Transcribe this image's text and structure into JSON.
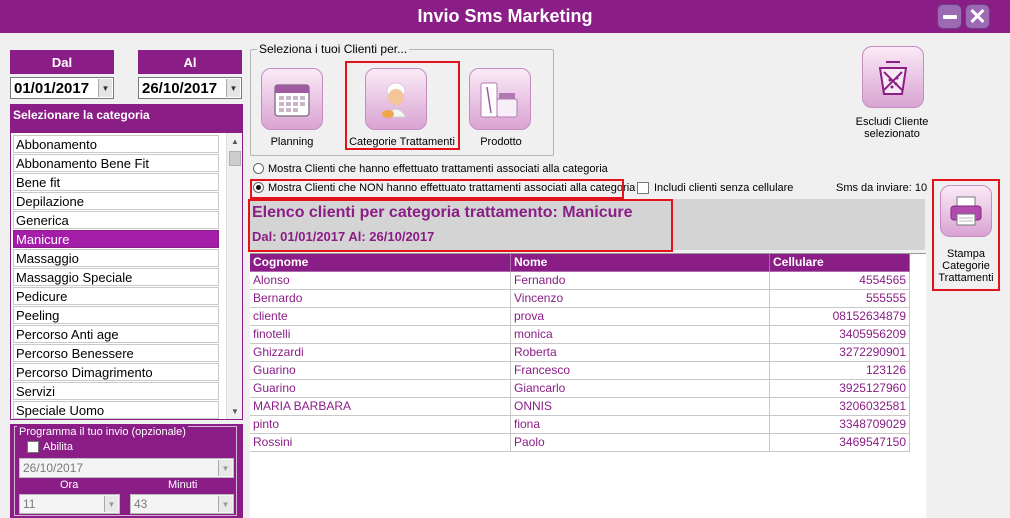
{
  "window": {
    "title": "Invio Sms Marketing"
  },
  "dates": {
    "from_label": "Dal",
    "from_value": "01/01/2017",
    "to_label": "Al",
    "to_value": "26/10/2017"
  },
  "categories": {
    "header": "Selezionare la categoria",
    "items": [
      "Abbonamento",
      "Abbonamento Bene Fit",
      "Bene fit",
      "Depilazione",
      "Generica",
      "Manicure",
      "Massaggio",
      "Massaggio Speciale",
      "Pedicure",
      "Peeling",
      "Percorso Anti age",
      "Percorso Benessere",
      "Percorso Dimagrimento",
      "Servizi",
      "Speciale Uomo"
    ],
    "selected": "Manicure"
  },
  "schedule": {
    "legend": "Programma il tuo invio (opzionale)",
    "enable_label": "Abilita",
    "date_value": "26/10/2017",
    "hour_label": "Ora",
    "minute_label": "Minuti",
    "hour_value": "11",
    "minute_value": "43"
  },
  "select_group": {
    "legend": "Seleziona i tuoi Clienti per...",
    "planning_label": "Planning",
    "categories_label": "Categorie Trattamenti",
    "product_label": "Prodotto"
  },
  "exclude_button": {
    "label": "Escludi Cliente selezionato"
  },
  "print_button": {
    "label": "Stampa Categorie Trattamenti"
  },
  "options": {
    "with_treatments": "Mostra Clienti che hanno effettuato trattamenti associati alla categoria",
    "without_treatments": "Mostra Clienti che NON hanno effettuato trattamenti associati alla categoria",
    "include_no_mobile": "Includi clienti senza cellulare",
    "sms_to_send_label": "Sms da inviare: 10"
  },
  "list": {
    "title": "Elenco clienti per categoria trattamento: Manicure",
    "subtitle": "Dal: 01/01/2017 Al: 26/10/2017",
    "columns": [
      "Cognome",
      "Nome",
      "Cellulare"
    ],
    "rows": [
      [
        "Alonso",
        "Fernando",
        "4554565"
      ],
      [
        "Bernardo",
        "Vincenzo",
        "555555"
      ],
      [
        "cliente",
        "prova",
        "08152634879"
      ],
      [
        "finotelli",
        "monica",
        "3405956209"
      ],
      [
        "Ghizzardi",
        "Roberta",
        "3272290901"
      ],
      [
        "Guarino",
        "Francesco",
        "123126"
      ],
      [
        "Guarino",
        "Giancarlo",
        "3925127960"
      ],
      [
        "MARIA BARBARA",
        "ONNIS",
        "3206032581"
      ],
      [
        "pinto",
        "fiona",
        "3348709029"
      ],
      [
        "Rossini",
        "Paolo",
        "3469547150"
      ]
    ]
  },
  "colors": {
    "accent": "#8a1d86",
    "highlight": "#e2131b"
  }
}
